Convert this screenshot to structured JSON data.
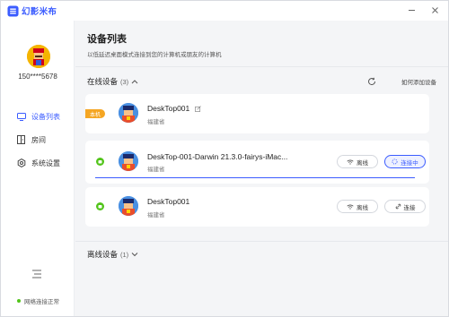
{
  "app": {
    "name": "幻影米布"
  },
  "user": {
    "id": "150****5678"
  },
  "sidebar": {
    "items": [
      {
        "label": "设备列表",
        "icon": "monitor-icon",
        "active": true
      },
      {
        "label": "房间",
        "icon": "door-icon",
        "active": false
      },
      {
        "label": "系统设置",
        "icon": "gear-icon",
        "active": false
      }
    ],
    "network_status": "网络连接正常"
  },
  "main": {
    "title": "设备列表",
    "subtitle": "以低延迟桌面模式连接到您的计算机或朋友的计算机",
    "online": {
      "label": "在线设备",
      "count": "(3)"
    },
    "add_device_link": "如何添加设备",
    "offline": {
      "label": "离线设备",
      "count": "(1)"
    }
  },
  "devices": [
    {
      "name": "DeskTop001",
      "location": "福建省",
      "badge": "本机"
    },
    {
      "name": "DeskTop-001-Darwin 21.3.0-fairys-iMac...",
      "location": "福建省",
      "offline_btn": "离线",
      "connect_btn": "连接中",
      "connecting": true,
      "progress": 1.0
    },
    {
      "name": "DeskTop001",
      "location": "福建省",
      "offline_btn": "离线",
      "connect_btn": "连接"
    }
  ],
  "colors": {
    "accent": "#3b5cff",
    "badge": "#f5a623",
    "online": "#52c41a"
  }
}
